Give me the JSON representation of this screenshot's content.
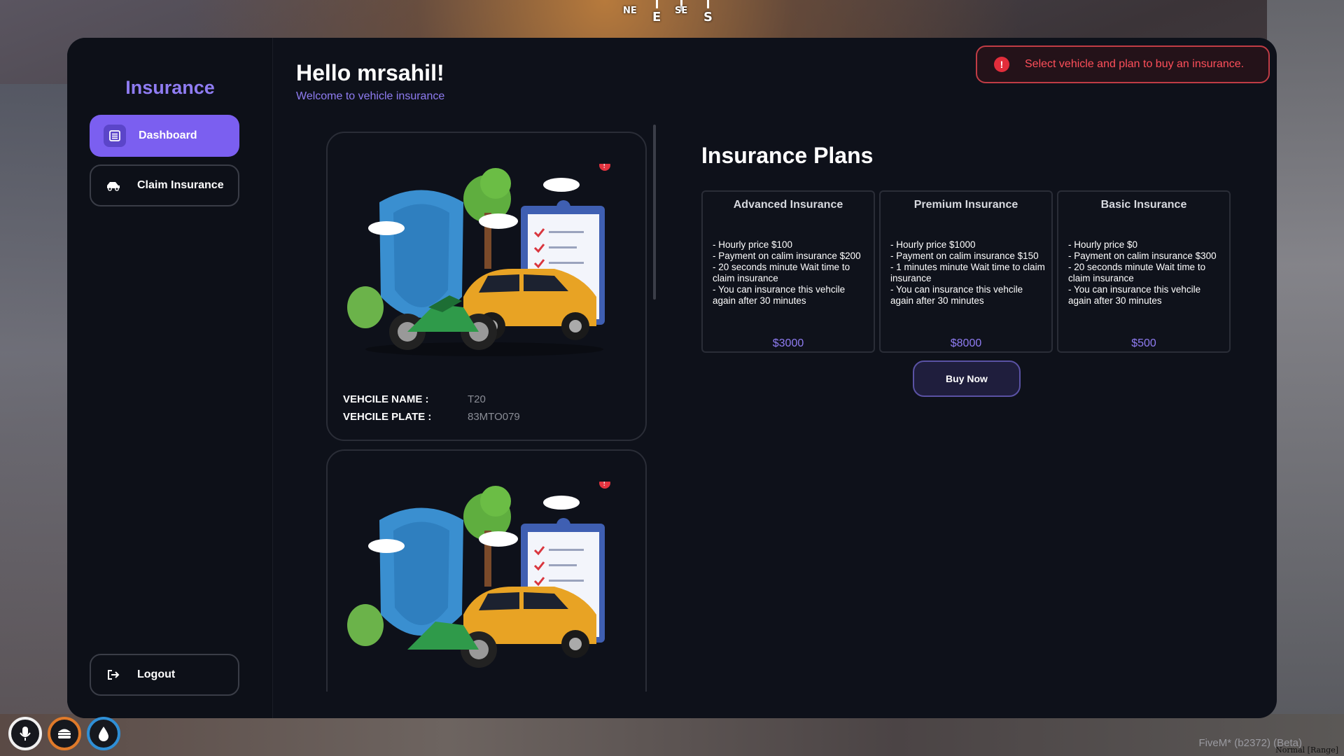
{
  "compass": {
    "ne": "NE",
    "e": "E",
    "se": "SE",
    "s": "S"
  },
  "app": {
    "title": "Insurance"
  },
  "sidebar": {
    "items": [
      {
        "label": "Dashboard",
        "icon": "list-icon"
      },
      {
        "label": "Claim Insurance",
        "icon": "car-hand-icon"
      }
    ],
    "logout": {
      "label": "Logout",
      "icon": "logout-icon"
    }
  },
  "header": {
    "title": "Hello mrsahil!",
    "subtitle": "Welcome to vehicle insurance"
  },
  "alert": {
    "text": "Select vehicle and plan to buy an insurance.",
    "icon": "exclamation-icon"
  },
  "vehicles": [
    {
      "name_label": "VEHCILE NAME :",
      "name": "T20",
      "plate_label": "VEHCILE PLATE :",
      "plate": "83MTO079"
    },
    {
      "name_label": "",
      "name": "",
      "plate_label": "",
      "plate": ""
    }
  ],
  "plans_title": "Insurance Plans",
  "plans": [
    {
      "name": "Advanced Insurance",
      "lines": [
        "- Hourly price $100",
        "- Payment on calim insurance $200",
        "- 20 seconds minute Wait time to claim insurance",
        "- You can insurance this vehcile again after 30 minutes"
      ],
      "price": "$3000"
    },
    {
      "name": "Premium Insurance",
      "lines": [
        "- Hourly price $1000",
        "- Payment on calim insurance $150",
        "- 1 minutes minute Wait time to claim insurance",
        "- You can insurance this vehcile again after 30 minutes"
      ],
      "price": "$8000"
    },
    {
      "name": "Basic Insurance",
      "lines": [
        "- Hourly price $0",
        "- Payment on calim insurance $300",
        "- 20 seconds minute Wait time to claim insurance",
        "- You can insurance this vehcile again after 30 minutes"
      ],
      "price": "$500"
    }
  ],
  "buy_label": "Buy Now",
  "footer": {
    "version": "FiveM* (b2372) (Beta)",
    "mode": "Normal [Range]"
  },
  "colors": {
    "accent": "#7b5ff0",
    "accent_text": "#8f7cf2",
    "alert": "#ff4f5a",
    "panel": "#0e111a"
  }
}
